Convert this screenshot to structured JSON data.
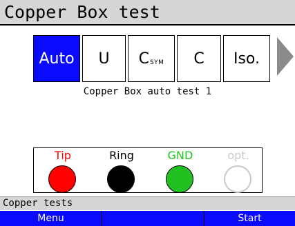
{
  "header": {
    "title": "Copper Box test"
  },
  "tabs": [
    {
      "label": "Auto",
      "active": true
    },
    {
      "label": "U"
    },
    {
      "label": "C",
      "sub": "SYM"
    },
    {
      "label": "C"
    },
    {
      "label": "Iso."
    }
  ],
  "next_icon": "chevron-right-icon",
  "description": "Copper Box auto test 1",
  "terminals": [
    {
      "label": "Tip",
      "color": "#ff0000",
      "label_color": "#ff0000"
    },
    {
      "label": "Ring",
      "color": "#000000",
      "label_color": "#000000"
    },
    {
      "label": "GND",
      "color": "#1fc01f",
      "label_color": "#1fc01f"
    },
    {
      "label": "opt.",
      "color": "#ffffff",
      "label_color": "#c8c8c8"
    }
  ],
  "status": {
    "text": "Copper tests"
  },
  "softkeys": {
    "left": "Menu",
    "middle": "",
    "right": "Start"
  },
  "colors": {
    "accent": "#0a0aff",
    "header_bg": "#d6d6d6",
    "arrow": "#8a8a8a"
  }
}
